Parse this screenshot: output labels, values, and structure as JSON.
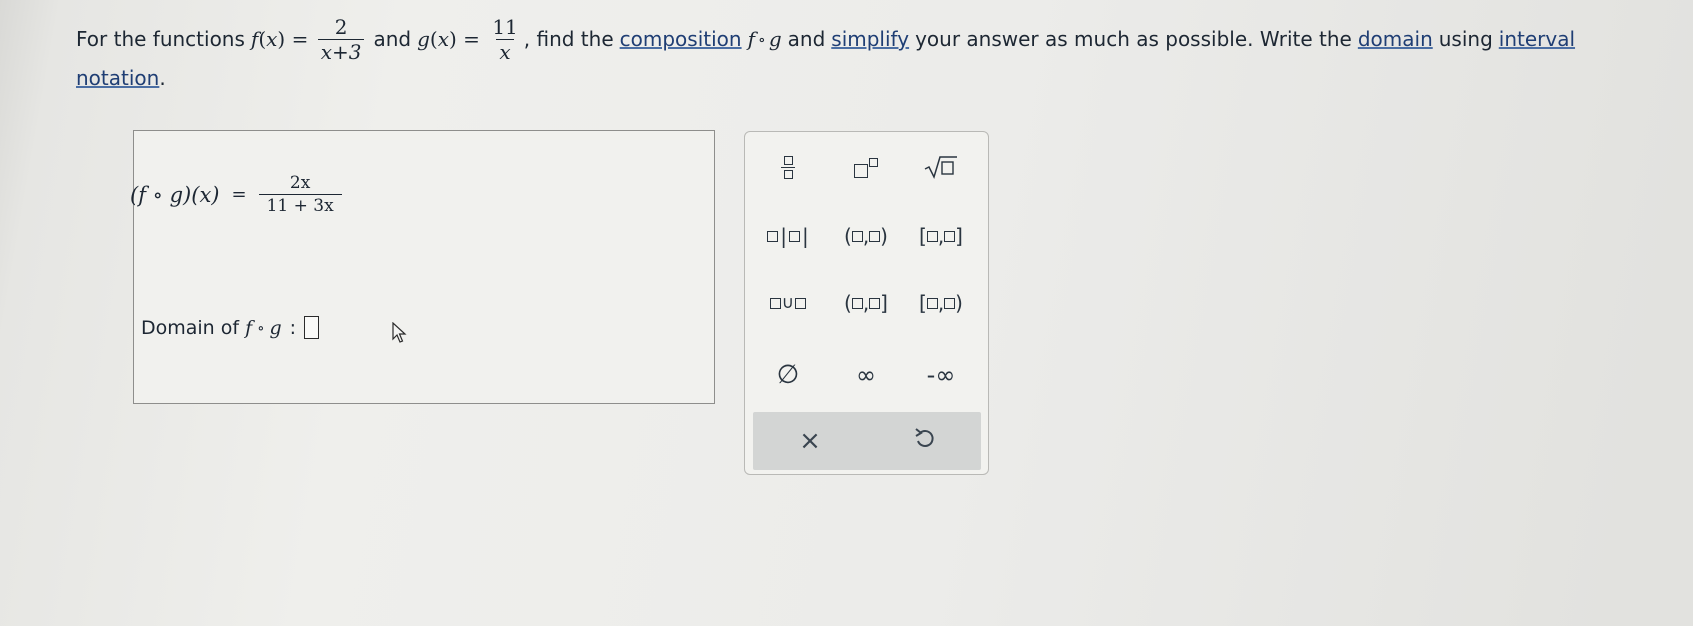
{
  "question": {
    "intro": "For the functions",
    "f_def": {
      "name": "f",
      "arg": "x",
      "num": "2",
      "den": "x+3"
    },
    "and": "and",
    "g_def": {
      "name": "g",
      "arg": "x",
      "num": "11",
      "den": "x"
    },
    "mid": ", find the",
    "link_composition": "composition",
    "comp_f": "f",
    "comp_op": "∘",
    "comp_g": "g",
    "and2": "and",
    "link_simplify": "simplify",
    "rest": "your answer as much as possible. Write the",
    "link_domain": "domain",
    "using": "using",
    "link_interval": "interval",
    "link_notation": "notation",
    "period": "."
  },
  "answer": {
    "lhs": "(f ∘ g)(x)",
    "equals": "=",
    "num": "2x",
    "den": "11 + 3x",
    "domain_label": "Domain of",
    "domain_f": "f",
    "domain_op": "∘",
    "domain_g": "g",
    "domain_colon": ":",
    "domain_value": ""
  },
  "palette": {
    "union": "∪",
    "empty_set": "∅",
    "infinity": "∞",
    "neg_infinity": "-∞",
    "clear_icon": "×",
    "undo_icon": "undo-icon"
  }
}
